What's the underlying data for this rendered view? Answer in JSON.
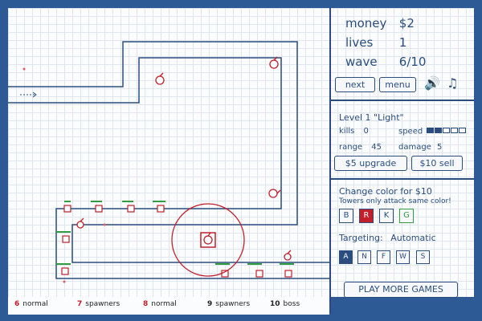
{
  "stats": {
    "money_label": "money",
    "money_value": "$2",
    "lives_label": "lives",
    "lives_value": "1",
    "wave_label": "wave",
    "wave_value": "6/10"
  },
  "buttons": {
    "next": "next",
    "menu": "menu"
  },
  "icons": {
    "sound": "speaker-icon",
    "music": "music-notes-icon",
    "spawn_arrow": "dotted-arrow-icon"
  },
  "tower": {
    "title": "Level 1 \"Light\"",
    "kills_label": "kills",
    "kills_value": "0",
    "speed_label": "speed",
    "speed_level": 0.4,
    "range_label": "range",
    "range_value": "45",
    "damage_label": "damage",
    "damage_value": "5",
    "upgrade_label": "$5 upgrade",
    "sell_label": "$10 sell"
  },
  "color": {
    "title": "Change color for $10",
    "subtitle": "Towers only attack same color!",
    "options": [
      "B",
      "R",
      "K",
      "G"
    ],
    "selected": "R",
    "swatch_colors": {
      "R": "#c21f2b",
      "G": "#2e9c3f",
      "B": "#2b4d7e",
      "K": "#111111"
    }
  },
  "targeting": {
    "label": "Targeting:",
    "value": "Automatic",
    "options": [
      "A",
      "N",
      "F",
      "W",
      "S"
    ],
    "selected": "A"
  },
  "play_more": "PLAY MORE GAMES",
  "waves": [
    {
      "num": "6",
      "label": "normal"
    },
    {
      "num": "7",
      "label": "spawners"
    },
    {
      "num": "8",
      "label": "normal"
    },
    {
      "num": "9",
      "label": "spawners"
    },
    {
      "num": "10",
      "label": "boss"
    }
  ],
  "colors": {
    "accent": "#2b4d7e",
    "frame": "#2d5a94",
    "enemy_red": "#c21f2b",
    "health_green": "#2e9c3f"
  }
}
